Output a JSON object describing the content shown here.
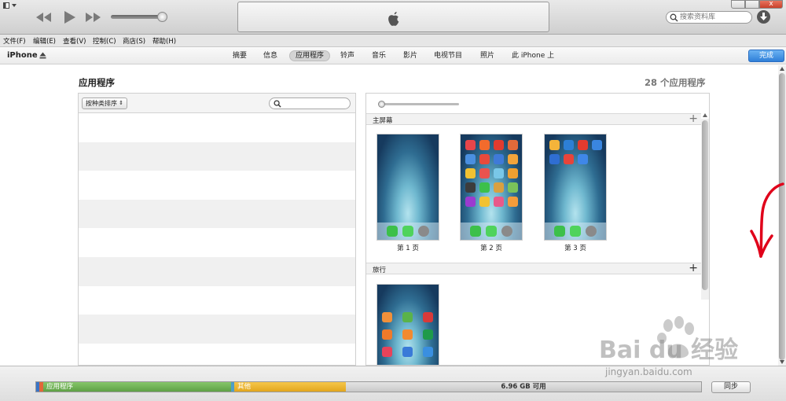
{
  "window": {
    "close_glyph": "x",
    "search_placeholder": "搜索资料库"
  },
  "menu": [
    "文件(F)",
    "编辑(E)",
    "查看(V)",
    "控制(C)",
    "商店(S)",
    "帮助(H)"
  ],
  "navbar": {
    "device": "iPhone",
    "tabs": [
      "摘要",
      "信息",
      "应用程序",
      "铃声",
      "音乐",
      "影片",
      "电视节目",
      "照片",
      "此 iPhone 上"
    ],
    "active_tab": "应用程序",
    "done_label": "完成"
  },
  "main": {
    "title": "应用程序",
    "app_count": "28 个应用程序",
    "sort_label": "按种类排序",
    "sort_chevron": "⇕",
    "search_value": "",
    "sections": [
      {
        "label": "主屏幕",
        "plus": "+"
      },
      {
        "label": "旅行",
        "plus": "+"
      }
    ],
    "pages": [
      {
        "label": "第 1 页"
      },
      {
        "label": "第 2 页"
      },
      {
        "label": "第 3 页"
      }
    ]
  },
  "storage": {
    "segments": [
      {
        "label": "应用程序",
        "color": "#6fb055"
      },
      {
        "label": "其他",
        "color": "#f0b830"
      },
      {
        "label": "6.96 GB 可用",
        "color": "#d0d0d0"
      }
    ],
    "sync_label": "同步"
  },
  "watermark": {
    "brand": "Bai du 经验",
    "url": "jingyan.baidu.com"
  },
  "colors": {
    "accent": "#2f7fd8",
    "annotation": "#e0001a"
  },
  "icons": [
    "rewind-icon",
    "play-icon",
    "fast-forward-icon",
    "apple-logo-icon",
    "search-icon",
    "download-icon",
    "eject-icon",
    "arrow-annotation-icon"
  ]
}
